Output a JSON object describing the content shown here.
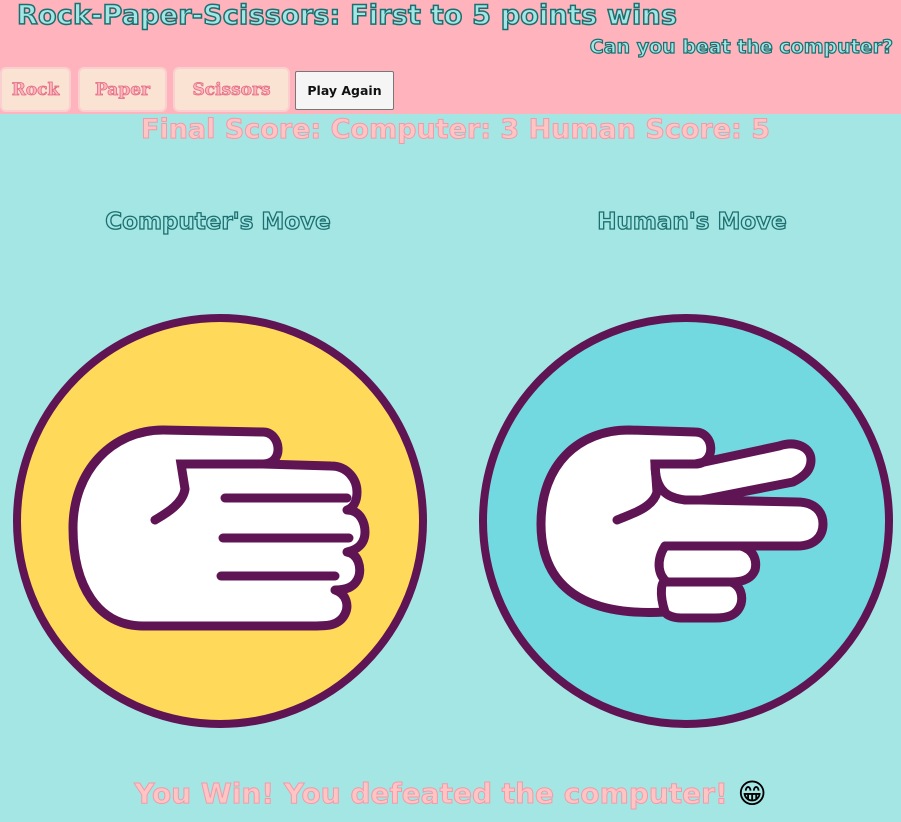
{
  "header": {
    "title": "Rock-Paper-Scissors: First to 5 points wins",
    "subtitle": "Can you beat the computer?"
  },
  "buttons": {
    "rock": "Rock",
    "paper": "Paper",
    "scissors": "Scissors",
    "play_again": "Play Again"
  },
  "score": {
    "text": "Final Score: Computer: 3 Human Score: 5"
  },
  "moves": {
    "computer_label": "Computer's Move",
    "human_label": "Human's Move",
    "computer_move": "paper-hand-icon",
    "human_move": "scissors-hand-icon"
  },
  "result": {
    "text": "You Win! You defeated the computer!",
    "emoji": "😁"
  },
  "colors": {
    "background": "#a4e6e4",
    "header": "#ffb3bd",
    "computer_circle": "#ffd95a",
    "human_circle": "#72d9e0",
    "hand_outline": "#5f1454"
  }
}
